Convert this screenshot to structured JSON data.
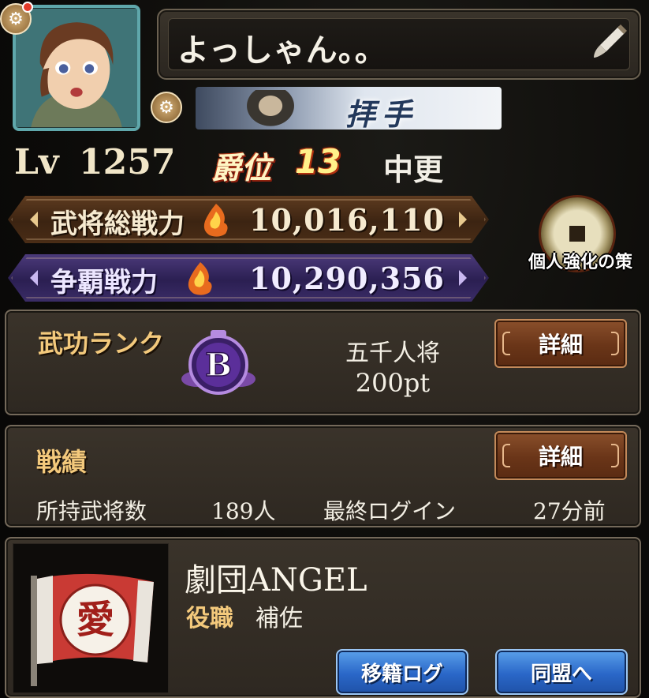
{
  "profile": {
    "name": "よっしゃん。。",
    "level_label": "Lv",
    "level": "1257",
    "rank_label": "爵位",
    "rank_value": "13",
    "rank_title": "中更",
    "banner_text": "拝手"
  },
  "power": {
    "general_label": "武将総戦力",
    "general_value": "10,016,110",
    "hegemony_label": "争覇戦力",
    "hegemony_value": "10,290,356"
  },
  "enhance": {
    "label": "個人強化の策"
  },
  "military_rank": {
    "title": "武功ランク",
    "badge_letter": "B",
    "rank_name": "五千人将",
    "points": "200pt",
    "detail_button": "詳細"
  },
  "record": {
    "title": "戦績",
    "detail_button": "詳細",
    "generals_label": "所持武将数",
    "generals_value": "189人",
    "last_login_label": "最終ログイン",
    "last_login_value": "27分前"
  },
  "alliance": {
    "flag_char": "愛",
    "name": "劇団ANGEL",
    "role_label": "役職",
    "role_value": "補佐",
    "transfer_log_button": "移籍ログ",
    "go_alliance_button": "同盟へ"
  },
  "colors": {
    "gold_text": "#f3c97c",
    "power_brown": "#3c2412",
    "power_purple": "#2b1f52",
    "blue_button": "#2a67c8",
    "detail_button": "#6a3518"
  }
}
